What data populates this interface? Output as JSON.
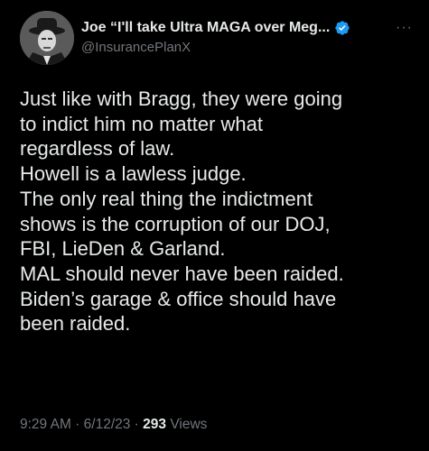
{
  "author": {
    "display_name": "Joe “I'll take Ultra MAGA over Meg...",
    "handle": "@InsurancePlanX",
    "verified": true
  },
  "tweet": {
    "lines": [
      "Just like with Bragg, they were going",
      "to indict him no matter what",
      "regardless of law.",
      "Howell is a lawless judge.",
      "The only real thing the indictment",
      "shows is the corruption of our DOJ,",
      "FBI, LieDen & Garland.",
      "MAL should never have been raided.",
      "Biden’s garage & office should have",
      "been raided."
    ]
  },
  "meta": {
    "time": "9:29 AM",
    "sep1": " · ",
    "date": "6/12/23",
    "sep2": " · ",
    "views_count": "293",
    "views_label": " Views"
  },
  "colors": {
    "background": "#000000",
    "text": "#e7e9ea",
    "secondary": "#71767b",
    "verified_blue": "#1d9bf0"
  },
  "icons": {
    "verified": "verified-badge-icon",
    "more": "more-options-icon"
  }
}
